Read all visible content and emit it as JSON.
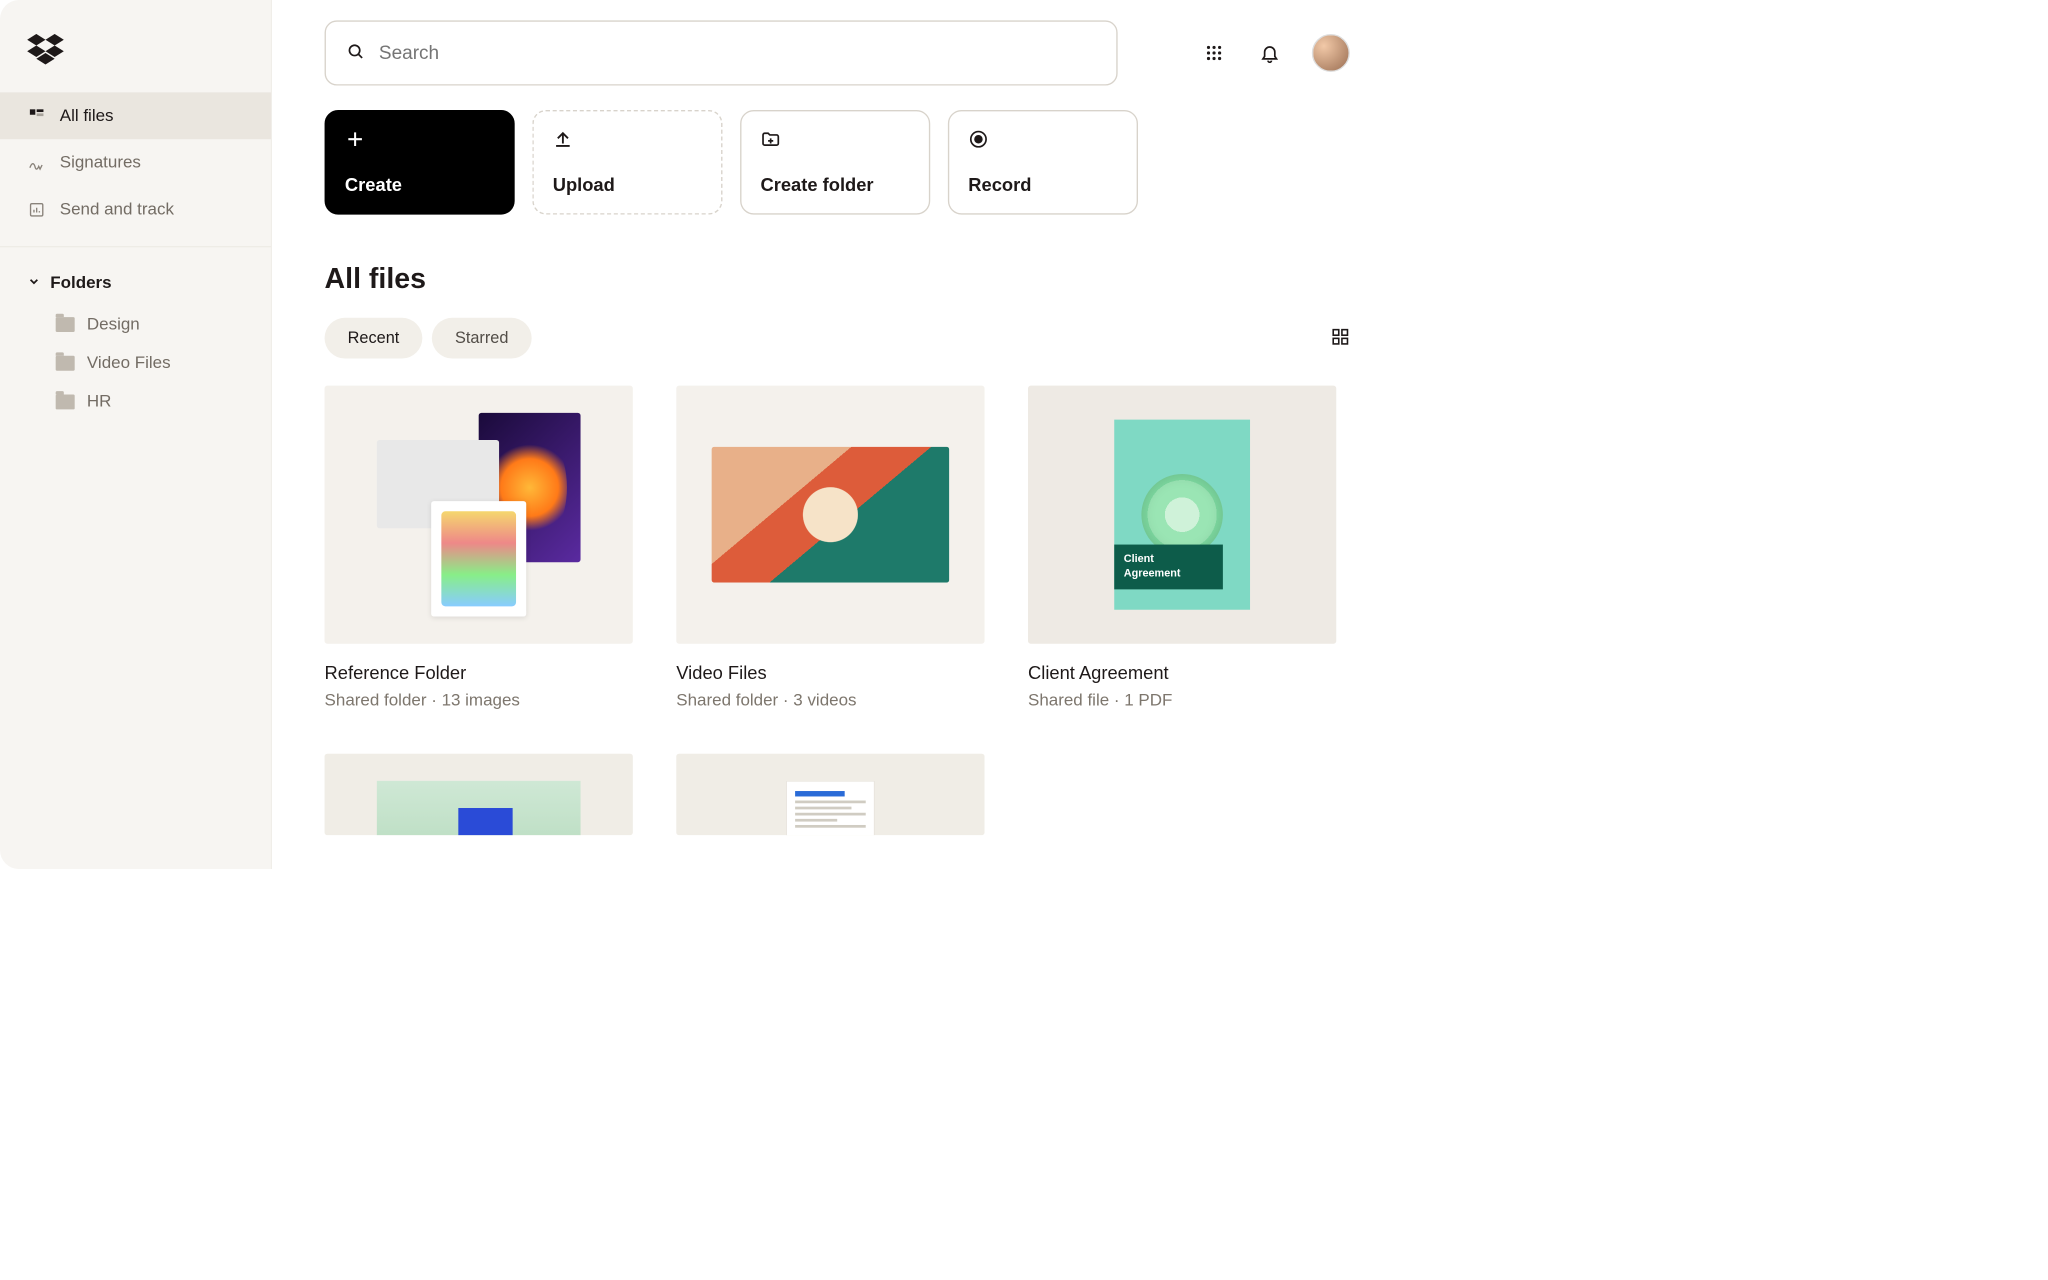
{
  "search": {
    "placeholder": "Search"
  },
  "sidebar": {
    "items": [
      {
        "label": "All files"
      },
      {
        "label": "Signatures"
      },
      {
        "label": "Send and track"
      }
    ],
    "folders_header": "Folders",
    "folders": [
      {
        "label": "Design"
      },
      {
        "label": "Video Files"
      },
      {
        "label": "HR"
      }
    ]
  },
  "actions": {
    "create": "Create",
    "upload": "Upload",
    "create_folder": "Create folder",
    "record": "Record"
  },
  "page_title": "All files",
  "filters": {
    "recent": "Recent",
    "starred": "Starred"
  },
  "files": [
    {
      "title": "Reference Folder",
      "subtitle": "Shared folder · 13 images"
    },
    {
      "title": "Video Files",
      "subtitle": "Shared folder · 3 videos"
    },
    {
      "title": "Client Agreement",
      "subtitle": "Shared file · 1 PDF",
      "pdf_label": "Client\nAgreement"
    }
  ]
}
